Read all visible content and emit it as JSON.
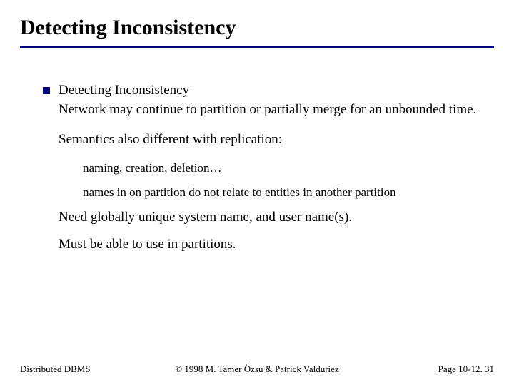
{
  "title": "Detecting Inconsistency",
  "bullet": {
    "heading": "Detecting Inconsistency",
    "body1": "Network may continue to partition or partially merge for an unbounded time.",
    "body2": "Semantics also different with replication:",
    "sub1": "naming, creation, deletion…",
    "sub2": "names in on partition do not relate to entities in another partition",
    "body3": "Need globally unique system name, and user name(s).",
    "body4": "Must be able to use in partitions."
  },
  "footer": {
    "left": "Distributed DBMS",
    "center": "© 1998 M. Tamer Özsu & Patrick Valduriez",
    "right": "Page 10-12. 31"
  }
}
